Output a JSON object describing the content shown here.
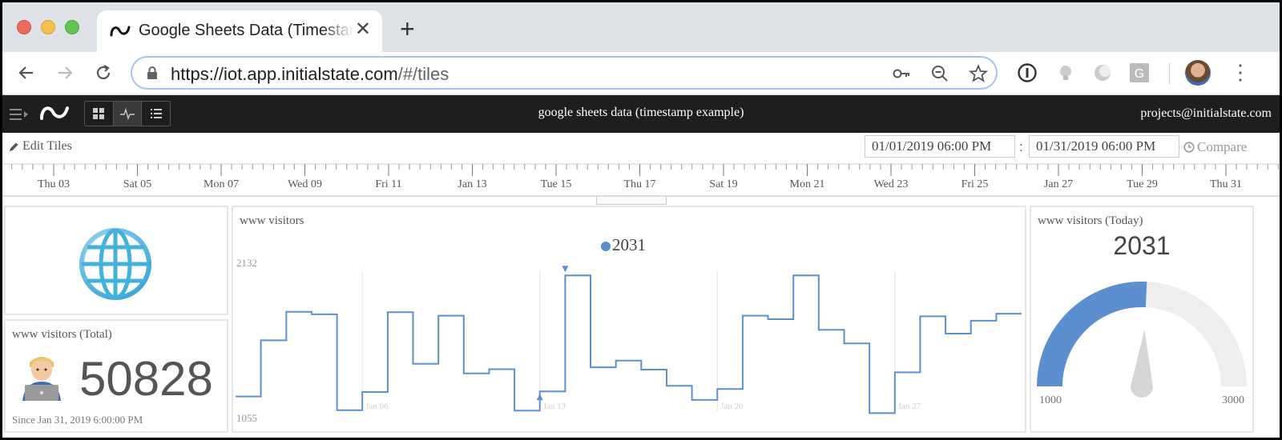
{
  "browser": {
    "tab_title": "Google Sheets Data (Timestamp Example)",
    "url_host": "https://iot.app.initialstate.com",
    "url_path": "/#/tiles",
    "new_tab": "+",
    "close": "✕"
  },
  "app": {
    "title": "google sheets data (timestamp example)",
    "user_email": "projects@initialstate.com",
    "view_modes": [
      "tiles",
      "waves",
      "lines"
    ],
    "active_view": "waves"
  },
  "toolbar": {
    "edit_tiles_label": "Edit Tiles",
    "start_date": "01/01/2019 06:00 PM",
    "separator": ":",
    "end_date": "01/31/2019 06:00 PM",
    "compare_label": "Compare"
  },
  "timeline": {
    "labels": [
      "Thu 03",
      "Sat 05",
      "Mon 07",
      "Wed 09",
      "Fri 11",
      "Jan 13",
      "Tue 15",
      "Thu 17",
      "Sat 19",
      "Mon 21",
      "Wed 23",
      "Fri 25",
      "Jan 27",
      "Tue 29",
      "Thu 31"
    ]
  },
  "tiles": {
    "total": {
      "title": "www visitors (Total)",
      "value": "50828",
      "since": "Since Jan 31, 2019 6:00:00 PM"
    },
    "chart": {
      "title": "www visitors",
      "legend_value": "2031"
    },
    "today": {
      "title": "www visitors (Today)",
      "value": "2031",
      "min_label": "1000",
      "max_label": "3000"
    }
  },
  "chart_data": [
    {
      "type": "line",
      "title": "www visitors",
      "step": true,
      "ylim": [
        1055,
        2132
      ],
      "ytick_labels": [
        "2132",
        "1055"
      ],
      "xtick_labels": [
        "Jan 06",
        "Jan 13",
        "Jan 20",
        "Jan 27"
      ],
      "xlim": [
        1,
        31
      ],
      "series": [
        {
          "name": "www visitors",
          "color": "#5b8fd0",
          "x": [
            1,
            2,
            3,
            4,
            5,
            6,
            7,
            8,
            9,
            10,
            11,
            12,
            13,
            14,
            15,
            16,
            17,
            18,
            19,
            20,
            21,
            22,
            23,
            24,
            25,
            26,
            27,
            28,
            29,
            30,
            31
          ],
          "values": [
            1168,
            1600,
            1820,
            1800,
            1063,
            1203,
            1817,
            1420,
            1790,
            1346,
            1378,
            1060,
            1207,
            2100,
            1393,
            1444,
            1375,
            1250,
            1142,
            1226,
            1790,
            1763,
            2100,
            1681,
            1577,
            1040,
            1354,
            1785,
            1652,
            1751,
            1805
          ]
        }
      ],
      "markers": [
        {
          "x": 13,
          "kind": "min"
        },
        {
          "x": 14,
          "kind": "max"
        }
      ]
    },
    {
      "type": "gauge",
      "title": "www visitors (Today)",
      "value": 2031,
      "min": 1000,
      "max": 3000,
      "fill_color": "#5b8fd0",
      "track_color": "#eeeeee"
    }
  ]
}
